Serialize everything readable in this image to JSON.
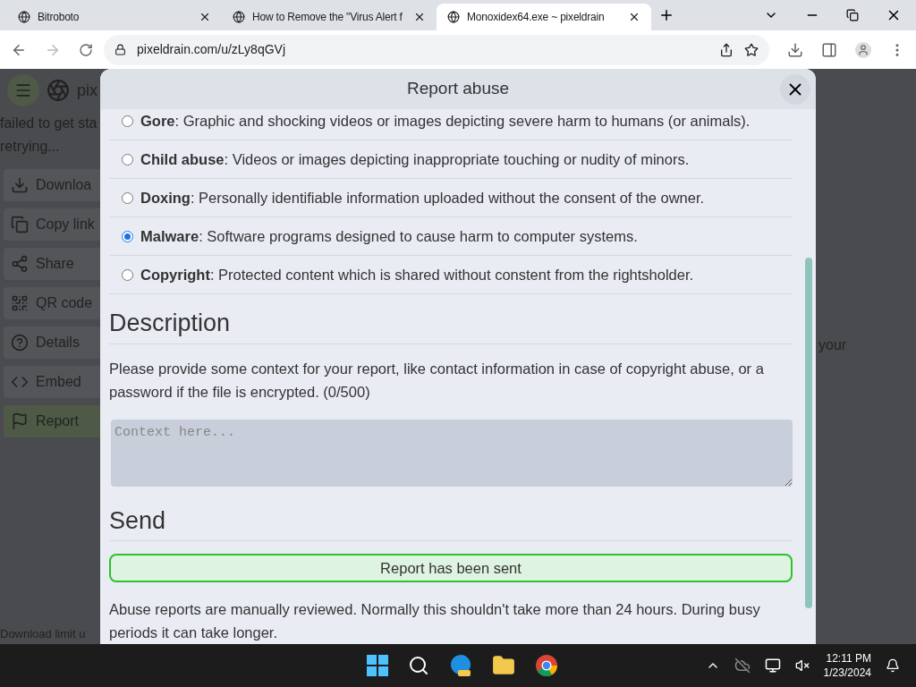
{
  "browser": {
    "tabs": [
      {
        "title": "Bitroboto",
        "selected": false
      },
      {
        "title": "How to Remove the \"Virus Alert f",
        "selected": false
      },
      {
        "title": "Monoxidex64.exe ~ pixeldrain",
        "selected": true
      }
    ],
    "address": "pixeldrain.com/u/zLy8qGVj"
  },
  "background": {
    "logo_text": "pix",
    "status": [
      "failed to get sta",
      "retrying..."
    ],
    "sidebar": [
      {
        "kind": "download",
        "label": "Downloa",
        "selected": false
      },
      {
        "kind": "copy",
        "label": "Copy link",
        "selected": false
      },
      {
        "kind": "share",
        "label": "Share",
        "selected": false
      },
      {
        "kind": "qr",
        "label": "QR code",
        "selected": false
      },
      {
        "kind": "details",
        "label": "Details",
        "selected": false
      },
      {
        "kind": "embed",
        "label": "Embed",
        "selected": false
      },
      {
        "kind": "report",
        "label": "Report",
        "selected": true
      }
    ],
    "right_text": "your",
    "footer": "Download limit u"
  },
  "modal": {
    "title": "Report abuse",
    "options": [
      {
        "text": "**Gore**: Graphic and shocking videos or images depicting severe harm to humans (or animals).",
        "selected": false
      },
      {
        "text": "**Child abuse**: Videos or images depicting inappropriate touching or nudity of minors.",
        "selected": false
      },
      {
        "text": "**Doxing**: Personally identifiable information uploaded without the consent of the owner.",
        "selected": false
      },
      {
        "text": "**Malware**: Software programs designed to cause harm to computer systems.",
        "selected": true
      },
      {
        "text": "**Copyright**: Protected content which is shared without constent from the rightsholder.",
        "selected": false
      }
    ],
    "description_heading": "Description",
    "description_text": "Please provide some context for your report, like contact information in case of copyright abuse, or a password if the file is encrypted. (0/500)",
    "context": {
      "placeholder": "Context here..."
    },
    "send_heading": "Send",
    "status": "Report has been sent",
    "note": "Abuse reports are manually reviewed. Normally this shouldn't take more than 24 hours. During busy periods it can take longer."
  },
  "taskbar": {
    "time": "12:11 PM",
    "date": "1/23/2024"
  }
}
